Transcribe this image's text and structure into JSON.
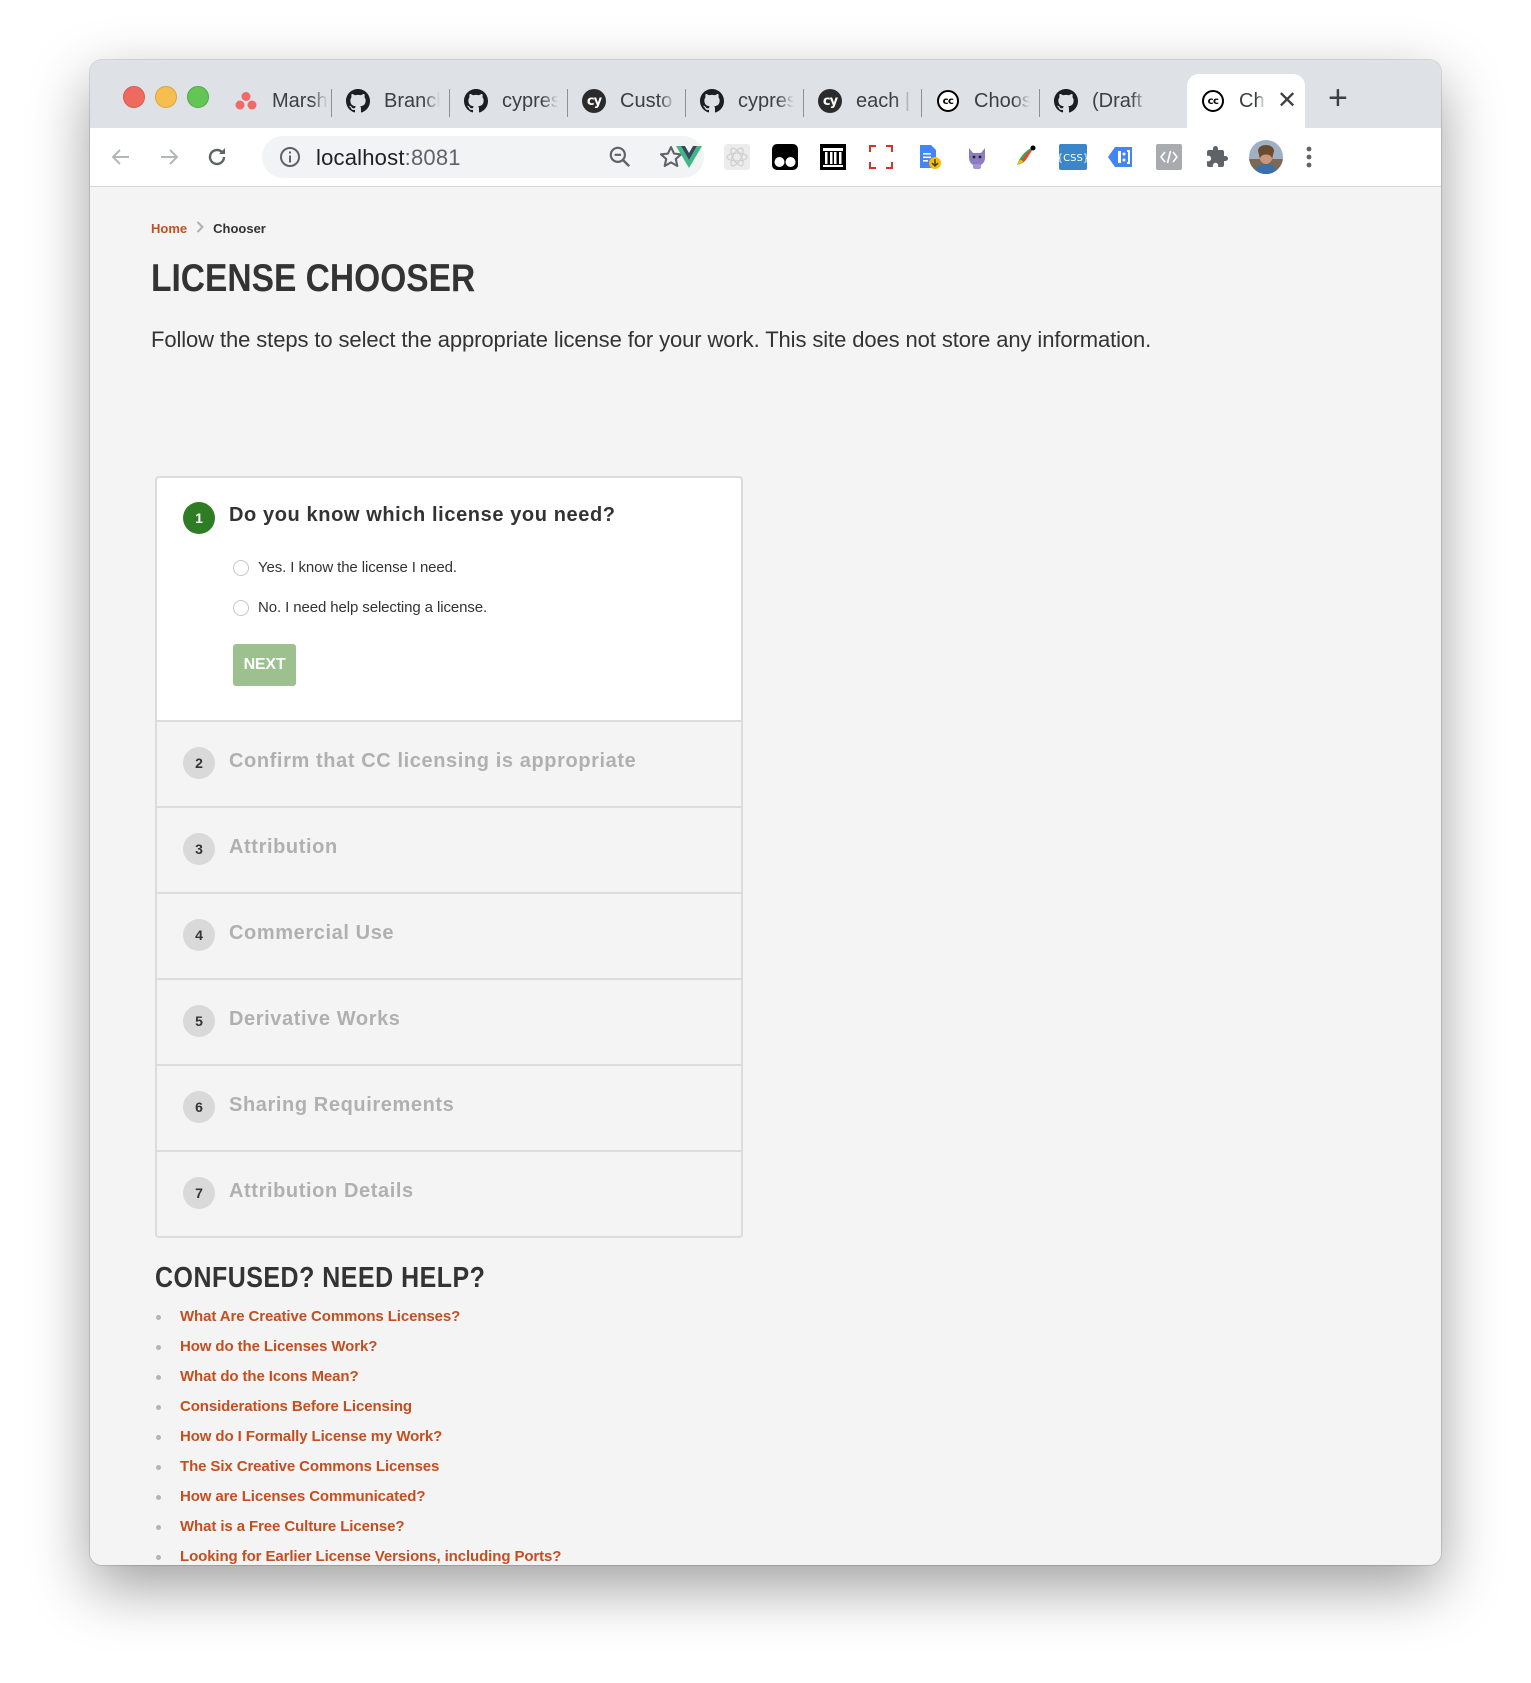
{
  "browser": {
    "tabs": [
      {
        "label": "Marsh",
        "icon": "asana-icon"
      },
      {
        "label": "Branch",
        "icon": "github-icon"
      },
      {
        "label": "cypress",
        "icon": "github-icon"
      },
      {
        "label": "Custo",
        "icon": "cypress-icon"
      },
      {
        "label": "cypress",
        "icon": "github-icon"
      },
      {
        "label": "each |",
        "icon": "cypress-icon"
      },
      {
        "label": "Choos",
        "icon": "creative-commons-icon"
      },
      {
        "label": "(Draft",
        "icon": "github-icon"
      },
      {
        "label": "Ch",
        "icon": "creative-commons-icon",
        "active": true
      }
    ],
    "url_host": "localhost",
    "url_port": ":8081",
    "extensions": [
      "vue-devtools-icon",
      "react-devtools-icon",
      "tampermonkey-icon",
      "archive-icon",
      "screenshot-icon",
      "docs-download-icon",
      "cat-extension-icon",
      "color-picker-icon",
      "css-viewer-icon",
      "tag-assistant-icon",
      "web-developer-icon",
      "extensions-puzzle-icon",
      "profile-avatar",
      "menu-kebab-icon"
    ],
    "colors": {
      "tabbar": "#dee1e6",
      "toolbar": "#ffffff"
    }
  },
  "breadcrumb": {
    "home": "Home",
    "current": "Chooser",
    "separator": "›"
  },
  "page": {
    "title": "LICENSE CHOOSER",
    "subtitle": "Follow the steps to select the appropriate license for your work. This site does not store any information."
  },
  "stepper": {
    "steps": [
      {
        "number": "1",
        "label": "Do you know which license you need?",
        "active": true
      },
      {
        "number": "2",
        "label": "Confirm that CC licensing is appropriate"
      },
      {
        "number": "3",
        "label": "Attribution"
      },
      {
        "number": "4",
        "label": "Commercial Use"
      },
      {
        "number": "5",
        "label": "Derivative Works"
      },
      {
        "number": "6",
        "label": "Sharing Requirements"
      },
      {
        "number": "7",
        "label": "Attribution Details"
      }
    ],
    "options": [
      {
        "label": "Yes. I know the license I need.",
        "checked": false
      },
      {
        "label": "No. I need help selecting a license.",
        "checked": false
      }
    ],
    "next_label": "NEXT"
  },
  "help": {
    "title": "CONFUSED? NEED HELP?",
    "links": [
      "What Are Creative Commons Licenses?",
      "How do the Licenses Work?",
      "What do the Icons Mean?",
      "Considerations Before Licensing",
      "How do I Formally License my Work?",
      "The Six Creative Commons Licenses",
      "How are Licenses Communicated?",
      "What is a Free Culture License?",
      "Looking for Earlier License Versions, including Ports?"
    ]
  },
  "colors": {
    "accent_link": "#c34f21",
    "active_step": "#2e7d25",
    "next_button_disabled": "#9cc18f",
    "page_bg": "#f4f4f4"
  }
}
